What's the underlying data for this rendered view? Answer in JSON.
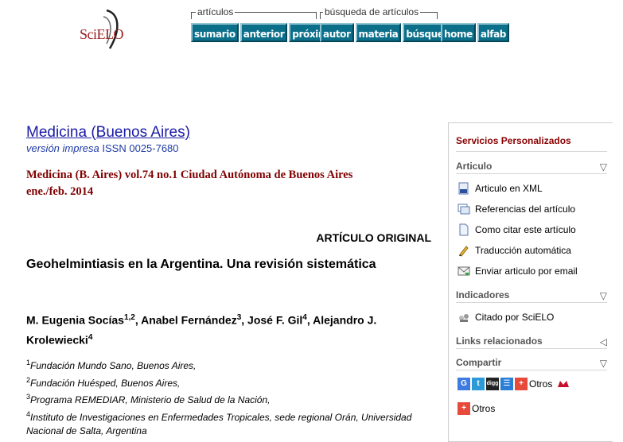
{
  "logo": {
    "text": "SciELO"
  },
  "nav": {
    "articles_label": "artículos",
    "search_label": "búsqueda de artículos",
    "summary": "sumario",
    "previous": "anterior",
    "next": "próximo",
    "author": "autor",
    "subject": "materia",
    "search": "búsqueda",
    "home": "home",
    "alpha": "alfab"
  },
  "journal": {
    "title": "Medicina (Buenos Aires)",
    "version_label": "versión impresa",
    "issn": "ISSN 0025-7680",
    "citation": "Medicina (B. Aires) vol.74 no.1 Ciudad Autónoma de Buenos Aires ene./feb. 2014"
  },
  "article": {
    "section": "ARTÍCULO ORIGINAL",
    "title": "Geohelmintiasis en la Argentina. Una revisión sistemática",
    "authors": [
      {
        "name": "M. Eugenia Socías",
        "sup": "1,2",
        "sep": ", "
      },
      {
        "name": "Anabel Fernández",
        "sup": "3",
        "sep": ", "
      },
      {
        "name": "José F. Gil",
        "sup": "4",
        "sep": ", "
      },
      {
        "name": "Alejandro J. Krolewiecki",
        "sup": "4",
        "sep": ""
      }
    ],
    "affiliations": [
      {
        "sup": "1",
        "text": "Fundación Mundo Sano, Buenos Aires,"
      },
      {
        "sup": "2",
        "text": "Fundación Huésped, Buenos Aires,"
      },
      {
        "sup": "3",
        "text": "Programa REMEDIAR, Ministerio de Salud de la Nación,"
      },
      {
        "sup": "4",
        "text": "Instituto de Investigaciones en Enfermedades Tropicales, sede regional Orán, Universidad Nacional de Salta, Argentina"
      }
    ]
  },
  "sidebar": {
    "title": "Servicios Personalizados",
    "article_section": "Articulo",
    "items": {
      "xml": "Articulo en XML",
      "refs": "Referencias del artículo",
      "cite": "Como citar este artículo",
      "translate": "Traducción automática",
      "email": "Enviar articulo por email"
    },
    "indicators_section": "Indicadores",
    "cited": "Citado por SciELO",
    "links_section": "Links relacionados",
    "share_section": "Compartir",
    "others_label": "Otros",
    "others_label_2": "Otros"
  },
  "colors": {
    "nav_button": "#0b6f8a",
    "journal_link": "#1a1aa6",
    "citation": "#800000",
    "sidebar_title": "#8b0000"
  }
}
